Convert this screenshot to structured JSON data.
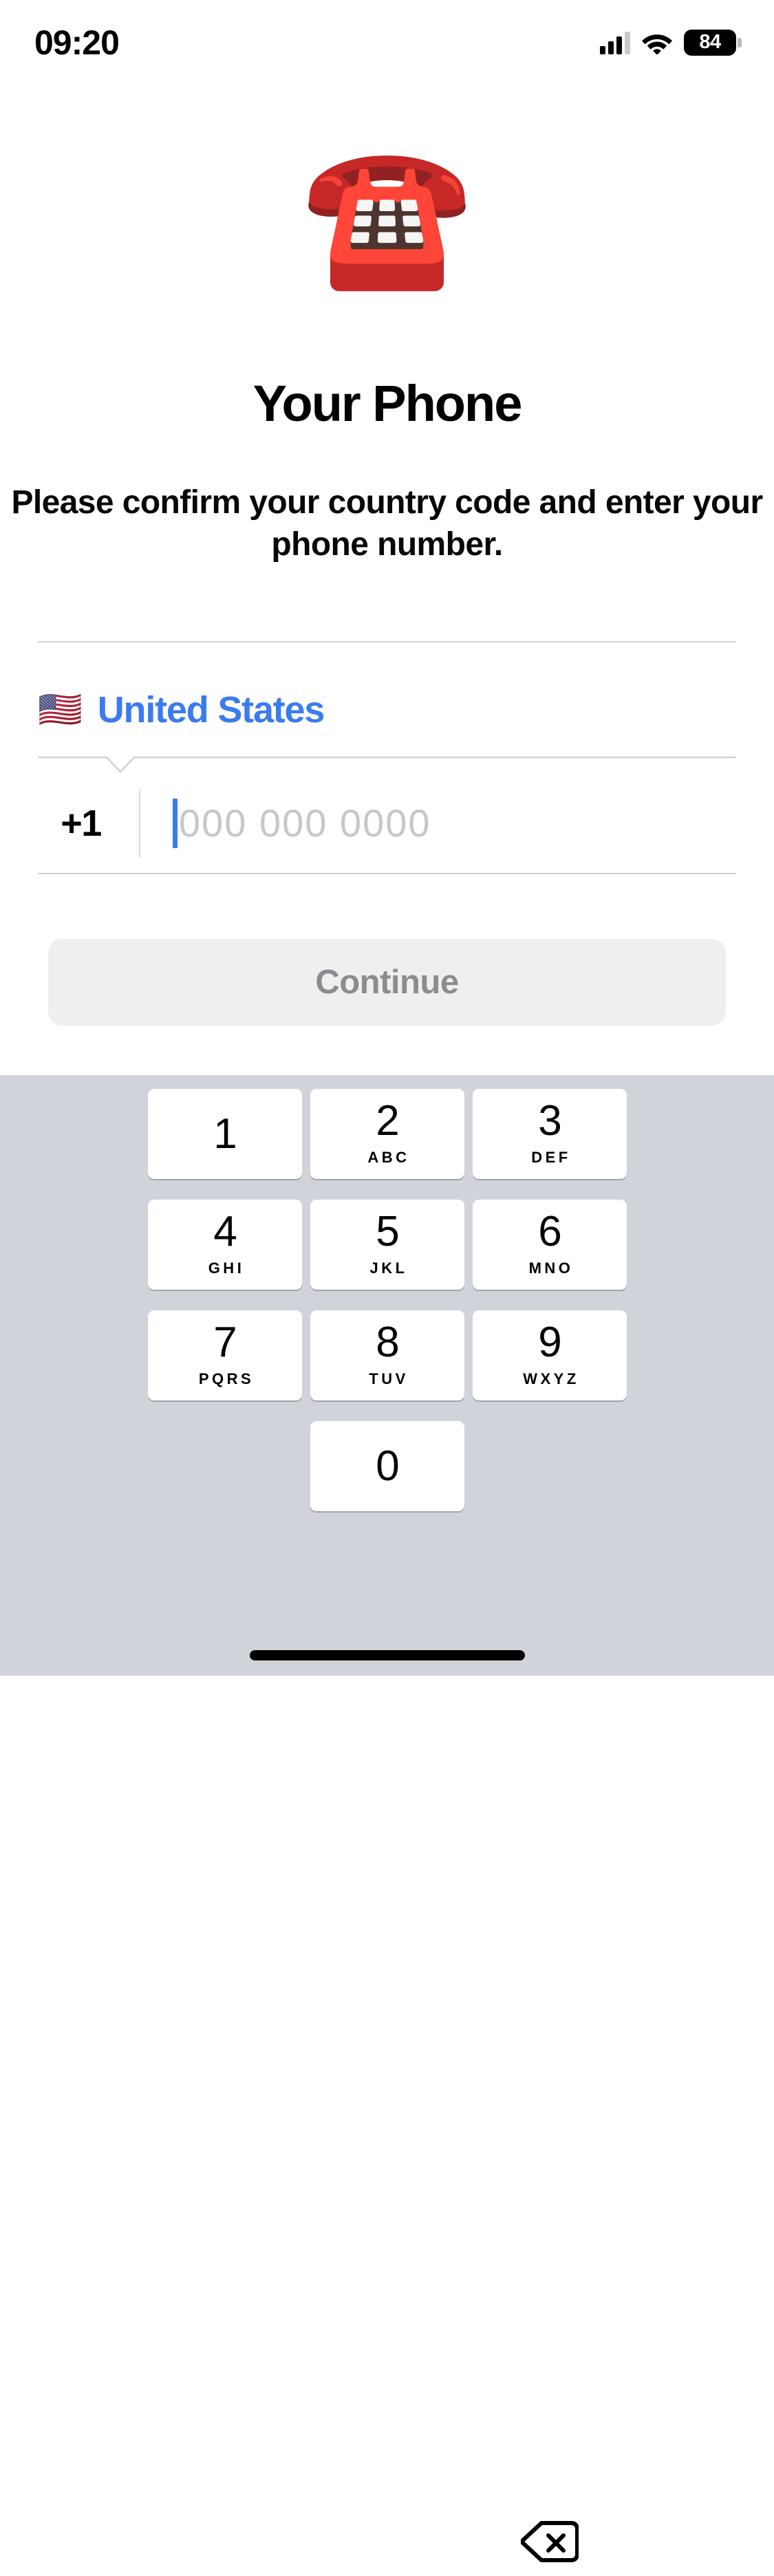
{
  "status_bar": {
    "time": "09:20",
    "cellular_icon": "cellular-signal-icon",
    "wifi_icon": "wifi-icon",
    "battery_icon": "battery-icon",
    "battery_level": "84"
  },
  "hero": {
    "emoji": "☎️",
    "emoji_name": "telephone-emoji",
    "title": "Your Phone",
    "subtitle": "Please confirm your country code and enter your phone number."
  },
  "form": {
    "country": {
      "flag": "🇺🇸",
      "flag_name": "united-states-flag-icon",
      "name": "United States",
      "color": "#3b7bf0"
    },
    "phone": {
      "dial_code": "+1",
      "value": "",
      "placeholder": "000 000 0000",
      "caret_color": "#3b7bf0",
      "placeholder_color": "#c6c6cb"
    },
    "continue_label": "Continue",
    "continue_bg": "#efeff0",
    "continue_text_color": "#8b8b90"
  },
  "keypad": {
    "background": "#d0d3d9",
    "key_bg": "#ffffff",
    "keys": [
      {
        "num": "1",
        "letters": ""
      },
      {
        "num": "2",
        "letters": "ABC"
      },
      {
        "num": "3",
        "letters": "DEF"
      },
      {
        "num": "4",
        "letters": "GHI"
      },
      {
        "num": "5",
        "letters": "JKL"
      },
      {
        "num": "6",
        "letters": "MNO"
      },
      {
        "num": "7",
        "letters": "PQRS"
      },
      {
        "num": "8",
        "letters": "TUV"
      },
      {
        "num": "9",
        "letters": "WXYZ"
      },
      {
        "num": "0",
        "letters": ""
      }
    ],
    "delete_icon": "backspace-delete-icon"
  },
  "home_indicator": "home-indicator"
}
